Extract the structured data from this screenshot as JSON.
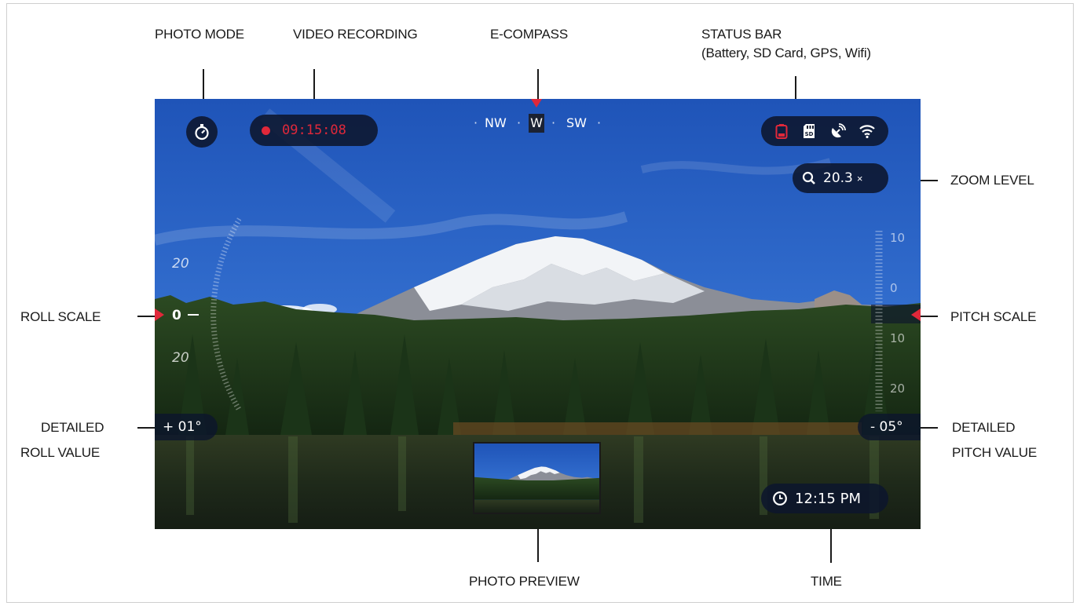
{
  "callouts": {
    "photo_mode": "PHOTO MODE",
    "video_recording": "VIDEO RECORDING",
    "e_compass": "E-COMPASS",
    "status_bar_line1": "STATUS BAR",
    "status_bar_line2": "(Battery, SD Card, GPS, Wifi)",
    "zoom_level": "ZOOM LEVEL",
    "roll_scale": "ROLL SCALE",
    "pitch_scale": "PITCH SCALE",
    "detailed_roll_line1": "DETAILED",
    "detailed_roll_line2": "ROLL VALUE",
    "detailed_pitch_line1": "DETAILED",
    "detailed_pitch_line2": "PITCH VALUE",
    "photo_preview": "PHOTO PREVIEW",
    "time": "TIME"
  },
  "hud": {
    "recording_time": "09:15:08",
    "compass": {
      "left": "NW",
      "center": "W",
      "right": "SW"
    },
    "zoom": "20.3",
    "zoom_suffix": "×",
    "roll_scale_labels": {
      "top": "20",
      "center": "0",
      "bottom": "20"
    },
    "pitch_scale_labels": {
      "top": "10",
      "center": "0",
      "bottom": "10",
      "lower": "20"
    },
    "roll_value": "+ 01°",
    "pitch_value": "- 05°",
    "clock": "12:15 PM",
    "status_icons": [
      "battery-icon",
      "sd-card-icon",
      "gps-icon",
      "wifi-icon"
    ]
  },
  "colors": {
    "accent_red": "#e0283a",
    "pill_bg": "#0c162c",
    "sky": "#2f63c8"
  }
}
